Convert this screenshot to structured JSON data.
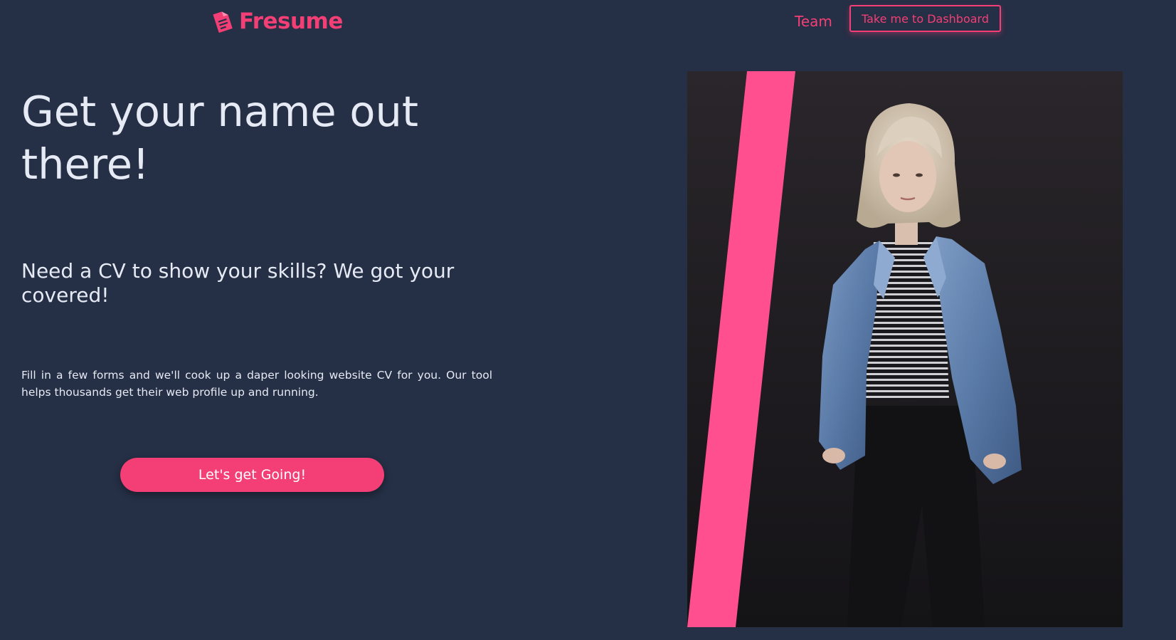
{
  "brand": {
    "name": "Fresume",
    "logo_icon": "document-icon",
    "accent_color": "#f43f76"
  },
  "nav": {
    "team_label": "Team",
    "dashboard_button_label": "Take me to Dashboard"
  },
  "hero": {
    "title": "Get your name out there!",
    "subtitle": "Need a CV to show your skills? We got your covered!",
    "description": "Fill in a few forms and we'll cook up a daper looking website CV for you. Our tool helps thousands get their web profile up and running.",
    "cta_label": "Let's get Going!",
    "image_subject": "woman-in-denim-jacket-photo"
  },
  "colors": {
    "background": "#252f45",
    "text": "#e6eaf4",
    "accent": "#f43f76",
    "photo_stripe": "#ff4f8f"
  }
}
